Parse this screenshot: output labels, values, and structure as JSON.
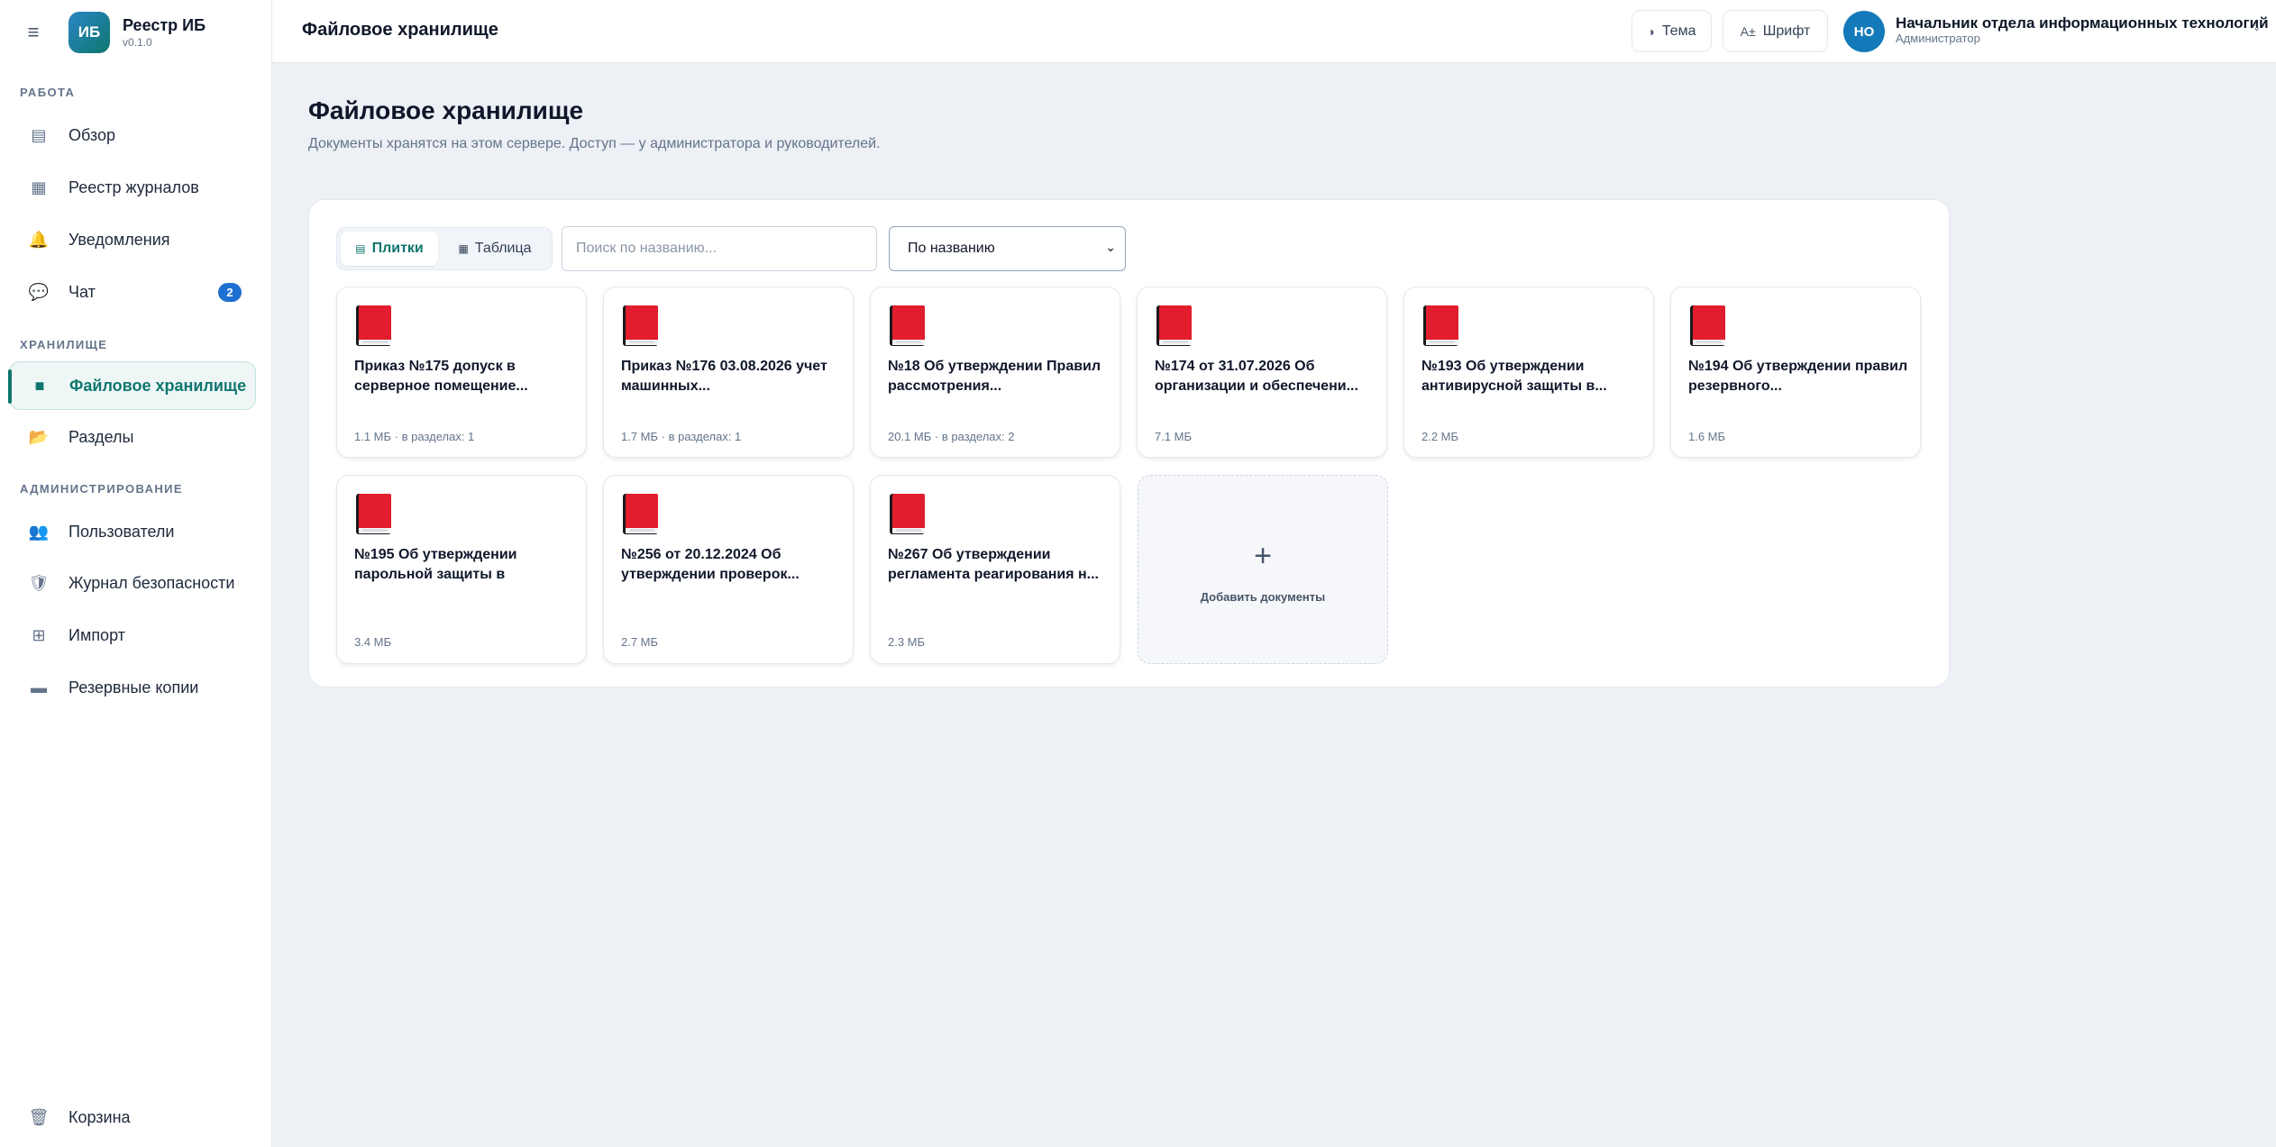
{
  "app": {
    "logo": "ИБ",
    "title": "Реестр ИБ",
    "version": "v0.1.0"
  },
  "sidebar": {
    "sections": {
      "work": "РАБОТА",
      "storage": "ХРАНИЛИЩЕ",
      "admin": "АДМИНИСТРИРОВАНИЕ"
    },
    "items": [
      {
        "label": "Обзор",
        "icon": "list-icon",
        "glyph": "▤"
      },
      {
        "label": "Реестр журналов",
        "icon": "grid-icon",
        "glyph": "▦"
      },
      {
        "label": "Уведомления",
        "icon": "bell-icon",
        "glyph": "🔔"
      },
      {
        "label": "Чат",
        "icon": "chat-icon",
        "glyph": "💬",
        "badge": "2"
      },
      {
        "label": "Файловое хранилище",
        "icon": "folder-icon",
        "glyph": "■",
        "active": true
      },
      {
        "label": "Разделы",
        "icon": "folder-open-icon",
        "glyph": "📂"
      },
      {
        "label": "Пользователи",
        "icon": "users-icon",
        "glyph": "👥"
      },
      {
        "label": "Журнал безопасности",
        "icon": "shield-icon",
        "glyph": "🛡"
      },
      {
        "label": "Импорт",
        "icon": "table-icon",
        "glyph": "⊞"
      },
      {
        "label": "Резервные копии",
        "icon": "backup-icon",
        "glyph": "▬"
      },
      {
        "label": "Корзина",
        "icon": "trash-icon",
        "glyph": "🗑"
      }
    ]
  },
  "header": {
    "title": "Файловое хранилище",
    "theme_label": "Тема",
    "font_label": "Шрифт",
    "user": {
      "initials": "НО",
      "name": "Начальник отдела информационных технологий",
      "role": "Администратор"
    }
  },
  "main": {
    "title": "Файловое хранилище",
    "subtitle": "Документы хранятся на этом сервере. Доступ — у администратора и руководителей.",
    "view_tiles": "Плитки",
    "view_table": "Таблица",
    "search_placeholder": "Поиск по названию...",
    "sort_value": "По названию",
    "add_label": "Добавить документы",
    "documents": [
      {
        "title": "Приказ №175 допуск в серверное помещение...",
        "meta": "1.1 МБ · в разделах: 1"
      },
      {
        "title": "Приказ №176 03.08.2026 учет машинных...",
        "meta": "1.7 МБ · в разделах: 1"
      },
      {
        "title": "№18 Об утверждении Правил рассмотрения...",
        "meta": "20.1 МБ · в разделах: 2"
      },
      {
        "title": "№174 от 31.07.2026 Об организации и обеспечени...",
        "meta": "7.1 МБ"
      },
      {
        "title": "№193 Об утверждении антивирусной защиты в...",
        "meta": "2.2 МБ"
      },
      {
        "title": "№194 Об утверждении правил резервного...",
        "meta": "1.6 МБ"
      },
      {
        "title": "№195 Об утверждении парольной защиты в",
        "meta": "3.4 МБ"
      },
      {
        "title": "№256 от 20.12.2024 Об утверждении проверок...",
        "meta": "2.7 МБ"
      },
      {
        "title": "№267 Об утверждении регламента реагирования н...",
        "meta": "2.3 МБ"
      }
    ]
  }
}
